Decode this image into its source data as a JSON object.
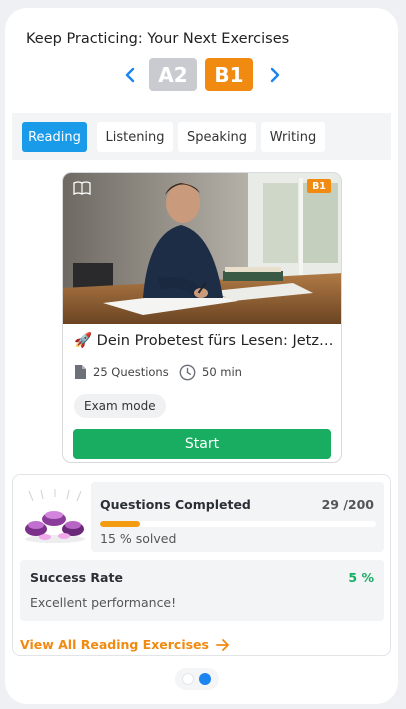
{
  "header": {
    "title": "Keep Practicing: Your Next Exercises"
  },
  "levels": {
    "prev": "A2",
    "current": "B1"
  },
  "tabs": [
    {
      "label": "Reading",
      "active": true
    },
    {
      "label": "Listening",
      "active": false
    },
    {
      "label": "Speaking",
      "active": false
    },
    {
      "label": "Writing",
      "active": false
    }
  ],
  "exercise": {
    "level_badge": "B1",
    "title": "🚀 Dein Probetest fürs Lesen: Jetz…",
    "questions": "25 Questions",
    "duration": "50 min",
    "mode": "Exam mode",
    "start_label": "Start"
  },
  "stats": {
    "completed_title": "Questions Completed",
    "completed_count": "29 /200",
    "progress_fraction": 0.145,
    "solved_text": "15 % solved",
    "success_title": "Success Rate",
    "success_value": "5 %",
    "success_sub": "Excellent performance!",
    "view_all": "View All Reading Exercises"
  },
  "colors": {
    "accent": "#1a9bea",
    "orange": "#f08a10",
    "green": "#19ad62"
  },
  "icons": [
    "chevron-left-icon",
    "chevron-right-icon",
    "book-icon",
    "document-icon",
    "clock-icon",
    "arrow-right-icon"
  ],
  "pager": {
    "pages": 2,
    "active": 2
  }
}
